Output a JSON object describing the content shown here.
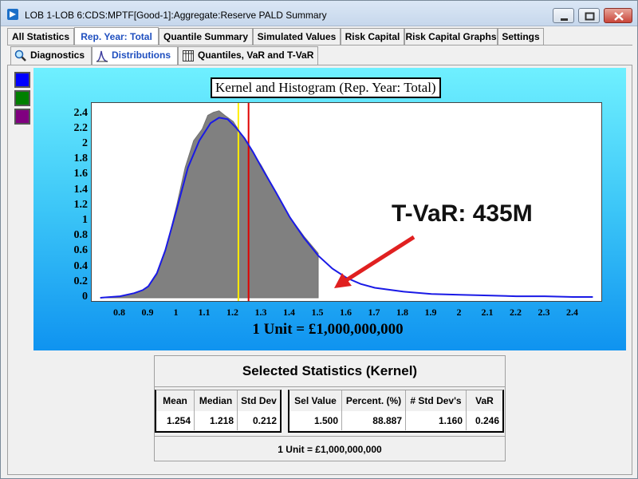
{
  "window": {
    "title": "LOB 1-LOB 6:CDS:MPTF[Good-1]:Aggregate:Reserve PALD Summary"
  },
  "tabs_main": [
    {
      "label": "All Statistics",
      "active": false
    },
    {
      "label": "Rep. Year: Total",
      "active": true
    },
    {
      "label": "Quantile Summary",
      "active": false
    },
    {
      "label": "Simulated Values",
      "active": false
    },
    {
      "label": "Risk Capital",
      "active": false
    },
    {
      "label": "Risk Capital Graphs",
      "active": false
    },
    {
      "label": "Settings",
      "active": false
    }
  ],
  "tabs_sub": [
    {
      "label": "Diagnostics",
      "icon": "magnifier-icon",
      "active": false
    },
    {
      "label": "Distributions",
      "icon": "distribution-icon",
      "active": true
    },
    {
      "label": "Quantiles, VaR and T-VaR",
      "icon": "table-icon",
      "active": false
    }
  ],
  "swatches": [
    {
      "name": "blue",
      "color": "#0000ff"
    },
    {
      "name": "green",
      "color": "#008000"
    },
    {
      "name": "purple",
      "color": "#800080"
    }
  ],
  "annotation": {
    "text": "T-VaR: 435M",
    "arrow_color": "#e02020"
  },
  "chart_data": {
    "type": "area",
    "title": "Kernel and Histogram (Rep. Year: Total)",
    "xlabel": "1 Unit = £1,000,000,000",
    "ylabel": "",
    "x_ticks": [
      "0.8",
      "0.9",
      "1",
      "1.1",
      "1.2",
      "1.3",
      "1.4",
      "1.5",
      "1.6",
      "1.7",
      "1.8",
      "1.9",
      "2",
      "2.1",
      "2.2",
      "2.3",
      "2.4"
    ],
    "y_ticks": [
      "2.4",
      "2.2",
      "2",
      "1.8",
      "1.6",
      "1.4",
      "1.2",
      "1",
      "0.8",
      "0.6",
      "0.4",
      "0.2",
      "0"
    ],
    "xlim": [
      0.7,
      2.5
    ],
    "ylim": [
      0,
      2.5
    ],
    "grid": false,
    "colors": {
      "kernel": "#1a1ae6",
      "histogram_fill": "#808080",
      "histogram_outline": "#707070",
      "yellow_line": "#ffee00",
      "red_line": "#e00000",
      "background_top": "#6ff0ff",
      "background_bottom": "#0f93f0"
    },
    "series": [
      {
        "x": [
          0.73,
          0.8,
          0.85,
          0.88,
          0.9,
          0.93,
          0.96,
          1.0,
          1.04,
          1.08,
          1.12,
          1.15,
          1.18,
          1.21,
          1.24,
          1.27,
          1.3,
          1.35,
          1.4,
          1.45,
          1.5,
          1.55,
          1.6,
          1.65,
          1.7,
          1.8,
          1.9,
          2.0,
          2.1,
          2.2,
          2.3,
          2.4,
          2.47
        ],
        "y": [
          0.0,
          0.02,
          0.06,
          0.1,
          0.15,
          0.32,
          0.62,
          1.15,
          1.7,
          2.05,
          2.28,
          2.35,
          2.33,
          2.22,
          2.08,
          1.9,
          1.7,
          1.38,
          1.05,
          0.78,
          0.55,
          0.38,
          0.26,
          0.18,
          0.13,
          0.08,
          0.05,
          0.04,
          0.03,
          0.02,
          0.02,
          0.01,
          0.01
        ]
      },
      {
        "x": [
          0.73,
          0.8,
          0.85,
          0.88,
          0.9,
          0.93,
          0.96,
          1.0,
          1.03,
          1.06,
          1.09,
          1.11,
          1.13,
          1.15,
          1.17,
          1.2,
          1.23,
          1.26,
          1.3,
          1.35,
          1.4,
          1.45,
          1.5
        ],
        "y": [
          0.0,
          0.02,
          0.06,
          0.1,
          0.15,
          0.3,
          0.6,
          1.2,
          1.7,
          2.05,
          2.2,
          2.38,
          2.42,
          2.44,
          2.38,
          2.3,
          2.12,
          1.95,
          1.72,
          1.38,
          1.05,
          0.8,
          0.58
        ]
      }
    ],
    "vlines": [
      {
        "x": 1.218,
        "color": "#ffee00"
      },
      {
        "x": 1.254,
        "color": "#e00000"
      }
    ],
    "histogram_cutoff": 1.5
  },
  "stats": {
    "title": "Selected Statistics (Kernel)",
    "left_headers": [
      "Mean",
      "Median",
      "Std Dev"
    ],
    "left_values": [
      "1.254",
      "1.218",
      "0.212"
    ],
    "right_headers": [
      "Sel Value",
      "Percent. (%)",
      "# Std Dev's",
      "VaR"
    ],
    "right_values": [
      "1.500",
      "88.887",
      "1.160",
      "0.246"
    ],
    "footer": "1 Unit = £1,000,000,000"
  }
}
